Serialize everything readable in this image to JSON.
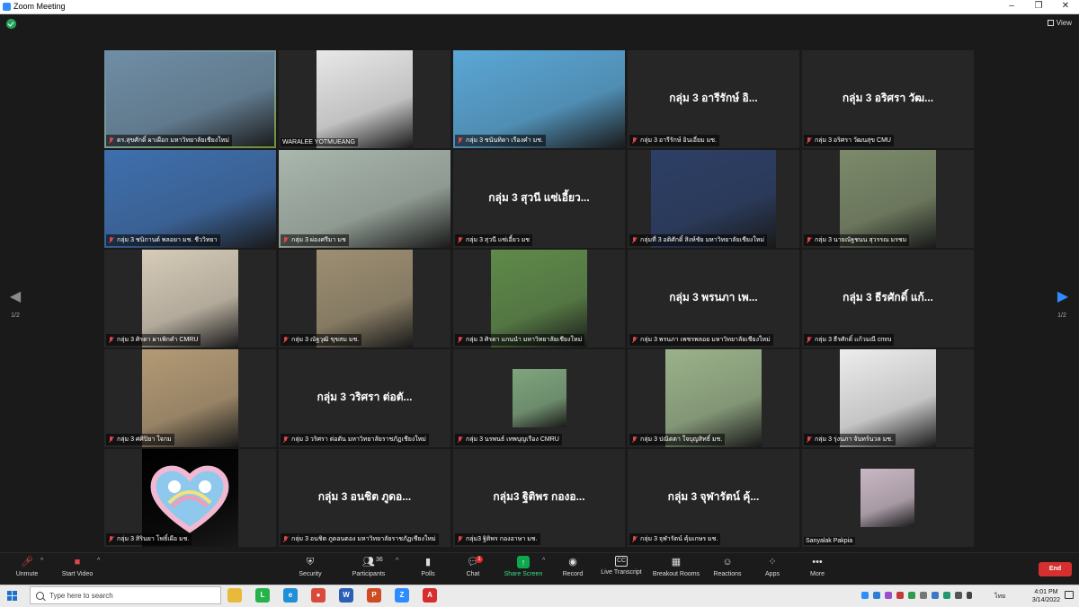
{
  "window": {
    "title": "Zoom Meeting",
    "view_label": "View",
    "min_glyph": "–",
    "max_glyph": "❐",
    "close_glyph": "✕"
  },
  "pagination": {
    "prev_page": "1/2",
    "next_page": "1/2",
    "prev_glyph": "◀",
    "next_glyph": "▶"
  },
  "participants": [
    {
      "label": "ดร.สุขศักดิ์ ผาเผือก มหาวิทยาลัยเชียงใหม่",
      "name_display": "",
      "video": true,
      "muted": true,
      "active": true,
      "bg": "#6f8ea6"
    },
    {
      "label": "WARALEE YOTMUEANG",
      "name_display": "",
      "video": true,
      "muted": false,
      "bg": "#e8e8e8"
    },
    {
      "label": "กลุ่ม 3 ชนันทิดา เรืองคำ มช.",
      "name_display": "",
      "video": true,
      "muted": true,
      "bg": "#5aa7d6"
    },
    {
      "label": "กลุ่ม 3 อารีรักษ์ อินเอี่ยม มช.",
      "name_display": "กลุ่ม 3 อารีรักษ์ อิ...",
      "video": false,
      "muted": true
    },
    {
      "label": "กลุ่ม 3 อริศรา วัฒนสุข CMU",
      "name_display": "กลุ่ม 3 อริศรา วัฒ...",
      "video": false,
      "muted": true
    },
    {
      "label": "กลุ่ม 3 ชนิกานต์ พลอยา มช. ชีววิทยา",
      "name_display": "",
      "video": true,
      "muted": true,
      "bg": "#3f6fae"
    },
    {
      "label": "กลุ่ม 3 ผ่องศรีมา มช",
      "name_display": "",
      "video": true,
      "muted": true,
      "bg": "#a9b7ad"
    },
    {
      "label": "กลุ่ม 3 สุวนี แซ่เอี้ยว มช",
      "name_display": "กลุ่ม 3 สุวนี แซ่เอี้ยว...",
      "video": false,
      "muted": true
    },
    {
      "label": "กลุ่มที่ 3 อติศักดิ์ สิงห์ชัย มหาวิทยาลัยเชียงใหม่",
      "name_display": "",
      "video": true,
      "muted": true,
      "bg": "#2c3f66"
    },
    {
      "label": "กลุ่ม 3 นายณัฐชนน สุวรรณ มรชม",
      "name_display": "",
      "video": true,
      "muted": true,
      "bg": "#7c8a6a"
    },
    {
      "label": "กลุ่ม 3 ศิรดา ผาเพิกคำ CMRU",
      "name_display": "",
      "video": true,
      "muted": true,
      "bg": "#d6cbb8"
    },
    {
      "label": "กลุ่ม 3 ณัฐวุฒิ ขุขสม มช.",
      "name_display": "",
      "video": true,
      "muted": true,
      "bg": "#9d8f72"
    },
    {
      "label": "กลุ่ม 3 ศิรดา แกนนำ มหาวิทยาลัยเชียงใหม่",
      "name_display": "",
      "video": true,
      "muted": true,
      "bg": "#5f8a4a"
    },
    {
      "label": "กลุ่ม 3 พรนภา เพชรพลอย มหาวิทยาลัยเชียงใหม่",
      "name_display": "กลุ่ม 3 พรนภา เพ...",
      "video": false,
      "muted": true
    },
    {
      "label": "กลุ่ม 3 ธีรศักดิ์ แก้วมณี cmru",
      "name_display": "กลุ่ม 3 ธีรศักดิ์ แก้...",
      "video": false,
      "muted": true
    },
    {
      "label": "กลุ่ม 3 ศศิปิยา ใจกม",
      "name_display": "",
      "video": true,
      "muted": true,
      "bg": "#b39a75"
    },
    {
      "label": "กลุ่ม 3 วริศรา ต่อตัน มหาวิทยาลัยราชภัฏเชียงใหม่",
      "name_display": "กลุ่ม 3 วริศรา ต่อตั...",
      "video": false,
      "muted": true
    },
    {
      "label": "กลุ่ม 3 นรพนธ์ เทพบุญเรือง CMRU",
      "name_display": "",
      "video": true,
      "muted": true,
      "bg": "#7ea57d"
    },
    {
      "label": "กลุ่ม 3 ปณิตตา ใจบุญสิทธิ์ มช.",
      "name_display": "",
      "video": true,
      "muted": true,
      "bg": "#9ab28a"
    },
    {
      "label": "กลุ่ม 3 รุ่งนภา จันทร์นวล มช.",
      "name_display": "",
      "video": true,
      "muted": true,
      "bg": "#ededed"
    },
    {
      "label": "กลุ่ม 3 สิรินยา โพธิ์เผือ มช.",
      "name_display": "",
      "video": true,
      "muted": true,
      "bg": "#000000",
      "heart": true
    },
    {
      "label": "กลุ่ม 3 อนชิต ภูดอนตอง มหาวิทยาลัยราชภัฏเชียงใหม่",
      "name_display": "กลุ่ม 3 อนชิต ภูดอ...",
      "video": false,
      "muted": true
    },
    {
      "label": "กลุ่ม3 ฐิติพร กองอาษา มช.",
      "name_display": "กลุ่ม3 ฐิติพร กองอ...",
      "video": false,
      "muted": true
    },
    {
      "label": "กลุ่ม 3 จุฬารัตน์ คุ้มเกษร มช.",
      "name_display": "กลุ่ม 3 จุฬารัตน์ คุ้...",
      "video": false,
      "muted": true
    },
    {
      "label": "Sanyalak Pakpia",
      "name_display": "",
      "video": true,
      "muted": false,
      "bg": "#c8b7c4"
    }
  ],
  "toolbar": {
    "unmute": "Unmute",
    "start_video": "Start Video",
    "security": "Security",
    "participants": "Participants",
    "participants_count": "36",
    "polls": "Polls",
    "chat": "Chat",
    "chat_badge": "1",
    "share_screen": "Share Screen",
    "record": "Record",
    "live_transcript": "Live Transcript",
    "breakout_rooms": "Breakout Rooms",
    "reactions": "Reactions",
    "apps": "Apps",
    "more": "More",
    "end": "End"
  },
  "taskbar": {
    "search_placeholder": "Type here to search",
    "language": "ไทย",
    "time": "4:01 PM",
    "date": "3/14/2022",
    "apps": [
      {
        "name": "file-explorer",
        "glyph": "",
        "color": "#e8b93a"
      },
      {
        "name": "line",
        "glyph": "L",
        "color": "#26b24b"
      },
      {
        "name": "edge",
        "glyph": "e",
        "color": "#1f8fd6"
      },
      {
        "name": "chrome",
        "glyph": "●",
        "color": "#d94a3a"
      },
      {
        "name": "word",
        "glyph": "W",
        "color": "#2b5fb5"
      },
      {
        "name": "powerpoint",
        "glyph": "P",
        "color": "#d04a22"
      },
      {
        "name": "zoom",
        "glyph": "Z",
        "color": "#2d8cff"
      },
      {
        "name": "acrobat",
        "glyph": "A",
        "color": "#d72d2d"
      }
    ]
  },
  "colors": {
    "active_speaker": "#a8d94a",
    "end_button": "#d62f2f",
    "share_green": "#0ea74d",
    "muted_red": "#e04848"
  }
}
